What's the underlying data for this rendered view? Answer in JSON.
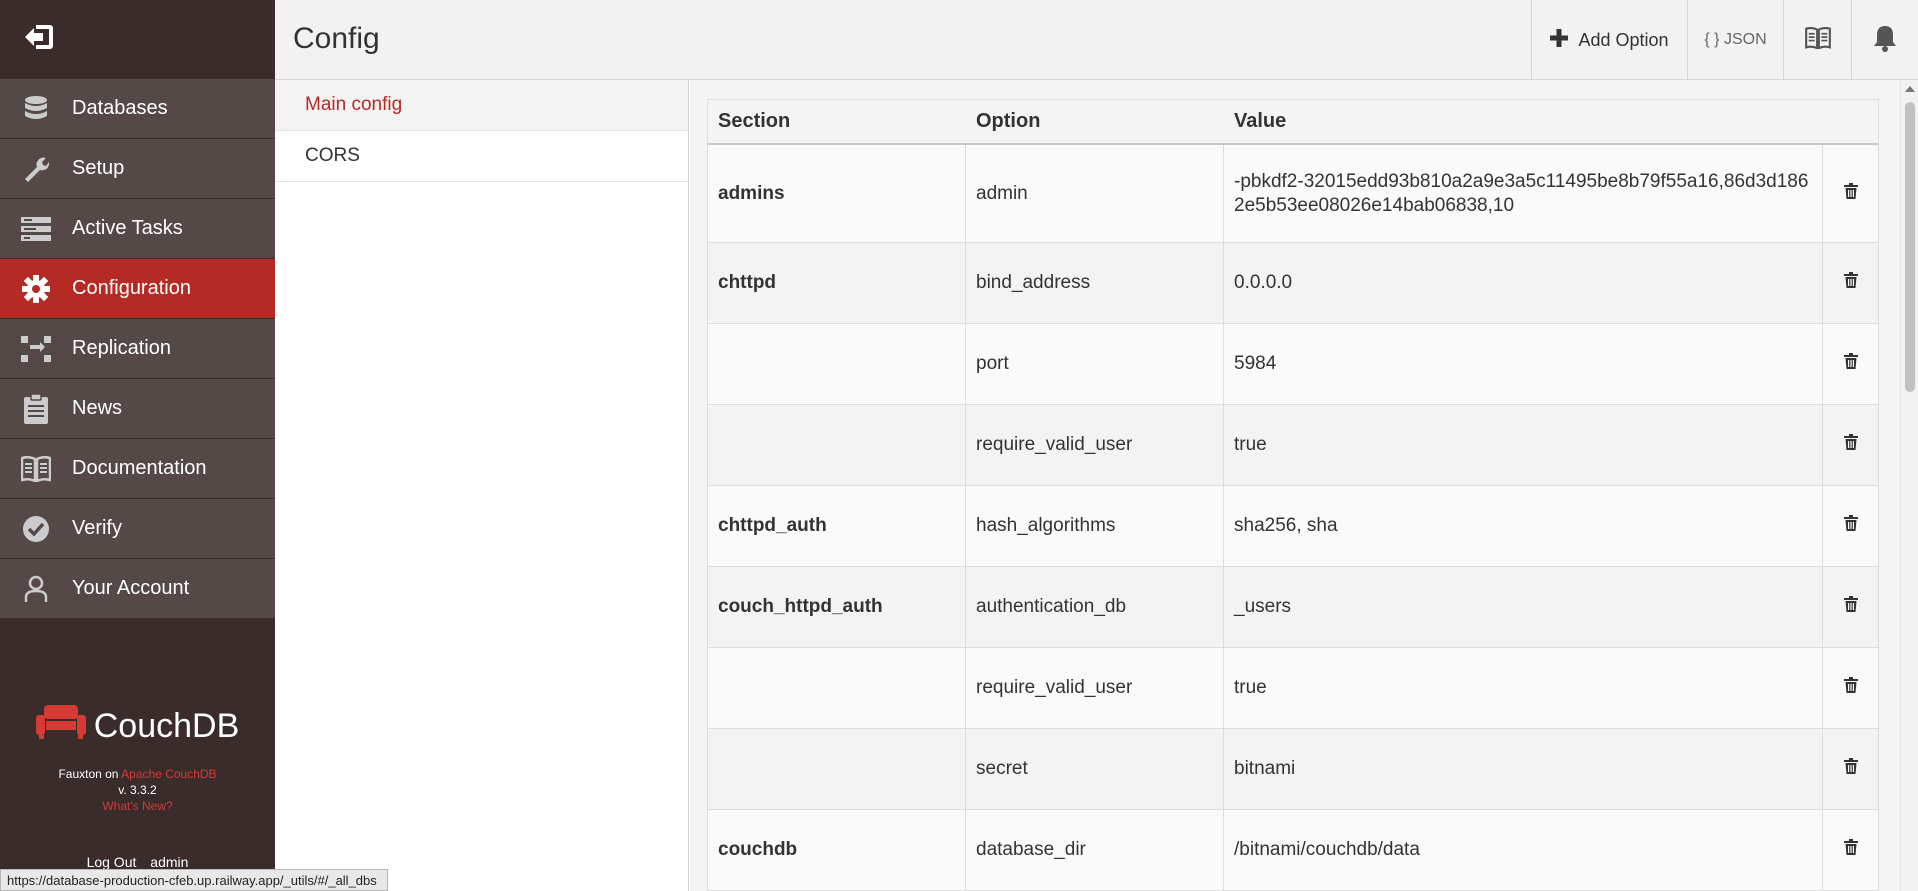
{
  "header": {
    "title": "Config",
    "add_option_label": "Add Option",
    "json_label": "{ } JSON"
  },
  "sidebar": {
    "items": [
      {
        "label": "Databases",
        "icon": "database-icon"
      },
      {
        "label": "Setup",
        "icon": "wrench-icon"
      },
      {
        "label": "Active Tasks",
        "icon": "tasks-icon"
      },
      {
        "label": "Configuration",
        "icon": "gear-icon",
        "active": true
      },
      {
        "label": "Replication",
        "icon": "replication-icon"
      },
      {
        "label": "News",
        "icon": "clipboard-icon"
      },
      {
        "label": "Documentation",
        "icon": "book-icon"
      },
      {
        "label": "Verify",
        "icon": "check-circle-icon"
      },
      {
        "label": "Your Account",
        "icon": "user-icon"
      }
    ],
    "brand": {
      "name": "CouchDB",
      "fauxton_on": "Fauxton on",
      "apache_link": "Apache CouchDB",
      "version": "v. 3.3.2",
      "whats_new": "What's New?"
    },
    "logout": "Log Out",
    "user": "admin"
  },
  "tabs": [
    {
      "label": "Main config",
      "active": true
    },
    {
      "label": "CORS",
      "active": false
    }
  ],
  "table": {
    "headers": {
      "section": "Section",
      "option": "Option",
      "value": "Value"
    },
    "rows": [
      {
        "section": "admins",
        "option": "admin",
        "value": "-pbkdf2-32015edd93b810a2a9e3a5c11495be8b79f55a16,86d3d1862e5b53ee08026e14bab06838,10"
      },
      {
        "section": "chttpd",
        "option": "bind_address",
        "value": "0.0.0.0"
      },
      {
        "section": "",
        "option": "port",
        "value": "5984"
      },
      {
        "section": "",
        "option": "require_valid_user",
        "value": "true"
      },
      {
        "section": "chttpd_auth",
        "option": "hash_algorithms",
        "value": "sha256, sha"
      },
      {
        "section": "couch_httpd_auth",
        "option": "authentication_db",
        "value": "_users"
      },
      {
        "section": "",
        "option": "require_valid_user",
        "value": "true"
      },
      {
        "section": "",
        "option": "secret",
        "value": "bitnami"
      },
      {
        "section": "couchdb",
        "option": "database_dir",
        "value": "/bitnami/couchdb/data"
      }
    ]
  },
  "statusbar": {
    "url": "https://database-production-cfeb.up.railway.app/_utils/#/_all_dbs"
  },
  "colors": {
    "sidebar_bg": "#3a2c2b",
    "nav_item_bg": "#544947",
    "accent": "#b52a24"
  }
}
